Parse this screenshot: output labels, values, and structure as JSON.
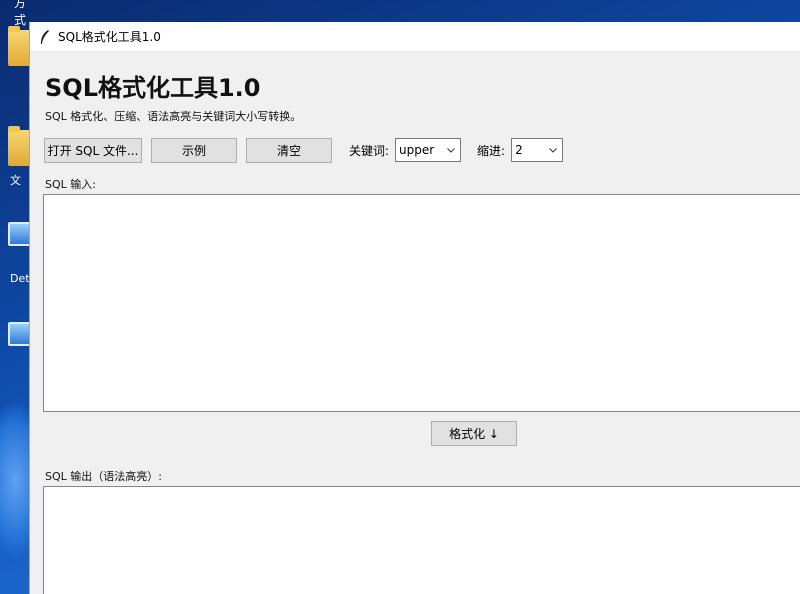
{
  "desktop": {
    "top_text": "方式",
    "icons": [
      {
        "type": "folder",
        "label": ""
      },
      {
        "type": "folder",
        "label": "文"
      },
      {
        "type": "computer",
        "label": "Det"
      },
      {
        "type": "computer",
        "label": ""
      }
    ]
  },
  "window": {
    "title": "SQL格式化工具1.0",
    "icon": "feather-icon"
  },
  "header": {
    "heading": "SQL格式化工具1.0",
    "subtitle": "SQL 格式化、压缩、语法高亮与关键词大小写转换。"
  },
  "toolbar": {
    "open_label": "打开 SQL 文件...",
    "example_label": "示例",
    "clear_label": "清空",
    "keyword_label": "关键词:",
    "keyword_value": "upper",
    "indent_label": "缩进:",
    "indent_value": "2"
  },
  "input": {
    "label": "SQL 输入:",
    "value": ""
  },
  "format_button": {
    "label": "格式化 ↓"
  },
  "output": {
    "label": "SQL 输出（语法高亮）:",
    "value": ""
  },
  "colors": {
    "window_bg": "#f0f0f0",
    "button_bg": "#e1e1e1",
    "desktop_blue": "#0f4aa8"
  }
}
